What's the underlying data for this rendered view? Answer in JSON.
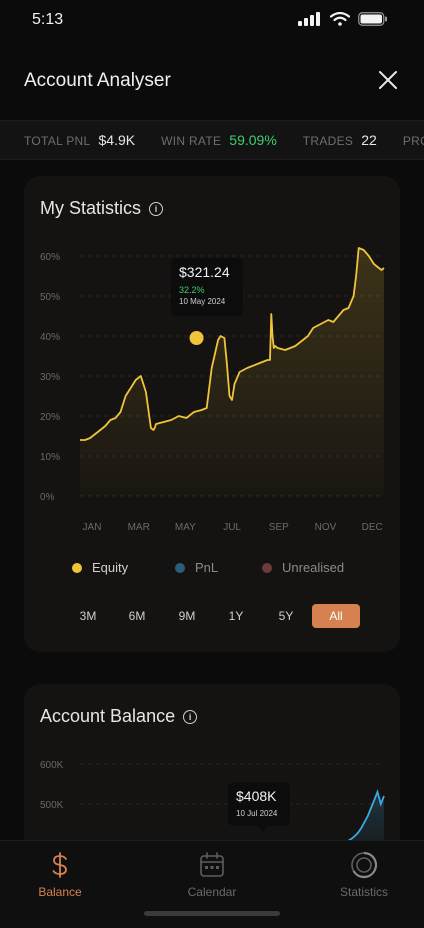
{
  "status": {
    "time": "5:13"
  },
  "header": {
    "title": "Account Analyser"
  },
  "ticker": {
    "items": [
      {
        "label": "TOTAL PNL",
        "value": "$4.9K"
      },
      {
        "label": "WIN RATE",
        "value": "59.09%"
      },
      {
        "label": "TRADES",
        "value": "22"
      },
      {
        "label": "PROF",
        "value": ""
      }
    ]
  },
  "stats_card": {
    "title": "My Statistics",
    "tooltip": {
      "value": "$321.24",
      "pct": "32.2%",
      "date": "10 May 2024"
    },
    "legend": [
      "Equity",
      "PnL",
      "Unrealised"
    ],
    "ranges": [
      "3M",
      "6M",
      "9M",
      "1Y",
      "5Y",
      "All"
    ],
    "active_range": "All"
  },
  "balance_card": {
    "title": "Account Balance",
    "tooltip": {
      "value": "$408K",
      "date": "10 Jul 2024"
    }
  },
  "tabs": [
    {
      "label": "Balance",
      "active": true
    },
    {
      "label": "Calendar",
      "active": false
    },
    {
      "label": "Statistics",
      "active": false
    }
  ],
  "colors": {
    "accent": "#d68250",
    "equity": "#f0c43a",
    "pnl": "#2a5f7a",
    "unrealised": "#6e3a3a",
    "positive": "#3ecf6b",
    "balance_line": "#3aa9e0"
  },
  "chart_data": [
    {
      "type": "line",
      "title": "My Statistics",
      "x_ticks": [
        "JAN",
        "MAR",
        "MAY",
        "JUL",
        "SEP",
        "NOV",
        "DEC"
      ],
      "y_ticks": [
        "0%",
        "10%",
        "20%",
        "30%",
        "40%",
        "50%",
        "60%"
      ],
      "ylim": [
        0,
        60
      ],
      "grid": true,
      "series": [
        {
          "name": "Equity",
          "x": [
            0,
            0.2,
            0.4,
            0.6,
            0.8,
            1.0,
            1.2,
            1.4,
            1.6,
            1.8,
            2.0,
            2.2,
            2.4,
            2.6,
            2.8,
            2.9,
            2.95,
            3.0,
            3.3,
            3.6,
            3.9,
            4.2,
            4.5,
            4.8,
            5.0,
            5.2,
            5.45,
            5.5,
            5.55,
            5.7,
            5.8,
            5.9,
            6.0,
            6.1,
            6.3,
            6.6,
            7.0,
            7.4,
            7.5,
            7.55,
            7.6,
            7.65,
            7.7,
            7.8,
            8.1,
            8.5,
            8.8,
            9.0,
            9.2,
            9.5,
            9.8,
            10.0,
            10.2,
            10.4,
            10.6,
            10.8,
            10.9,
            11.0,
            11.2,
            11.4,
            11.6,
            11.8,
            11.9,
            12.0
          ],
          "values": [
            14,
            14,
            14.5,
            15.5,
            16.5,
            17.5,
            19,
            19.5,
            21,
            25,
            27,
            29,
            30,
            26,
            17,
            16.5,
            17,
            18,
            18.5,
            19,
            20,
            19.5,
            21,
            21.5,
            22,
            32,
            39,
            39.5,
            40,
            39.5,
            33,
            25,
            24,
            28,
            31,
            32,
            33,
            34,
            34,
            45.5,
            40,
            37,
            37.5,
            37,
            36.5,
            37.5,
            39,
            40,
            42,
            43,
            44,
            43.5,
            45,
            46.5,
            47,
            50,
            55,
            62,
            61.5,
            60,
            58,
            57,
            56.5,
            57
          ]
        }
      ],
      "annotation": {
        "x": 4.6,
        "value": 39.5,
        "label": "$321.24",
        "pct": "32.2%",
        "date": "10 May 2024"
      }
    },
    {
      "type": "line",
      "title": "Account Balance",
      "y_ticks": [
        "500K",
        "600K"
      ],
      "grid": true,
      "series": [
        {
          "name": "",
          "x": [
            0,
            0.5,
            1,
            1.5,
            2,
            2.5,
            3,
            3.5,
            4,
            4.5,
            5,
            5.5,
            6,
            6.5,
            7,
            7.5,
            8,
            8.5,
            9,
            9.5,
            10,
            10.5,
            11,
            11.5,
            12
          ],
          "values": [
            405,
            408,
            410,
            414,
            418,
            420,
            425,
            430,
            433,
            436,
            440,
            446,
            452,
            458,
            463,
            470,
            478,
            490,
            505,
            520,
            540,
            560,
            580,
            550,
            570
          ]
        }
      ],
      "annotation": {
        "label": "$408K",
        "date": "10 Jul 2024"
      }
    }
  ]
}
